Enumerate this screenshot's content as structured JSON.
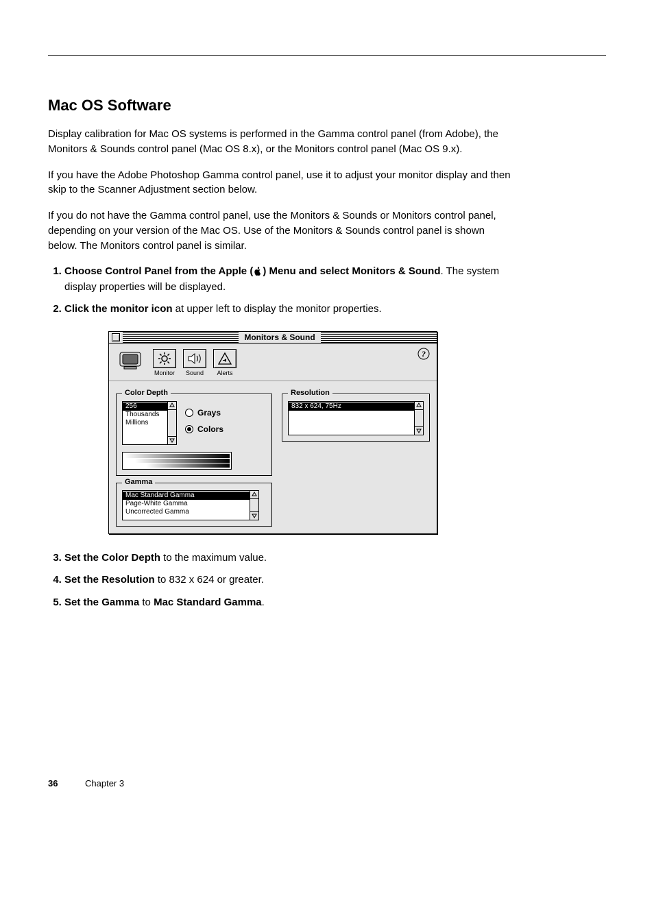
{
  "page": {
    "number": "36",
    "chapter": "Chapter 3"
  },
  "section": {
    "title": "Mac OS Software",
    "para1": "Display calibration for Mac OS systems is performed in the Gamma control panel (from Adobe), the Monitors & Sounds control panel (Mac OS 8.x), or the Monitors control panel (Mac OS 9.x).",
    "para2": "If you have the Adobe Photoshop Gamma control panel, use it to adjust your monitor display and then skip to the Scanner Adjustment section below.",
    "para3": "If you do not have the Gamma control panel, use the Monitors & Sounds or Monitors control panel, depending on your version of the Mac OS. Use of the Monitors & Sounds control panel is shown below. The Monitors control panel is similar."
  },
  "steps": {
    "step1_a": "Choose ",
    "step1_b": "Control Panel",
    "step1_c": " from the Apple (",
    "step1_d": ") Menu and select ",
    "step1_e": "Monitors & Sound",
    "step1_f": ". The system display properties will be displayed.",
    "step2_a": "Click the ",
    "step2_b": "monitor icon",
    "step2_c": " at upper left to display the monitor properties."
  },
  "window": {
    "title": "Monitors & Sound",
    "toolbar": {
      "monitor": "Monitor",
      "sound": "Sound",
      "alerts": "Alerts"
    },
    "help_icon": "help-icon",
    "groups": {
      "color_depth": "Color Depth",
      "resolution": "Resolution",
      "gamma": "Gamma"
    },
    "color_depth_items": [
      "256",
      "Thousands",
      "Millions"
    ],
    "color_depth_selected": "256",
    "radios": {
      "grays": "Grays",
      "colors": "Colors"
    },
    "resolution_items": [
      "832 x 624, 75Hz"
    ],
    "resolution_selected": "832 x 624, 75Hz",
    "gamma_items": [
      "Mac Standard Gamma",
      "Page-White Gamma",
      "Uncorrected Gamma"
    ],
    "gamma_selected": "Mac Standard Gamma"
  },
  "after": {
    "step3_a": "Set the ",
    "step3_b": "Color Depth",
    "step3_c": " to the maximum value.",
    "step4_a": "Set the ",
    "step4_b": "Resolution",
    "step4_c": " to 832 x 624 or greater.",
    "step5_a": "Set the ",
    "step5_b": "Gamma",
    "step5_c": " to ",
    "step5_d": "Mac Standard Gamma",
    "step5_e": "."
  }
}
